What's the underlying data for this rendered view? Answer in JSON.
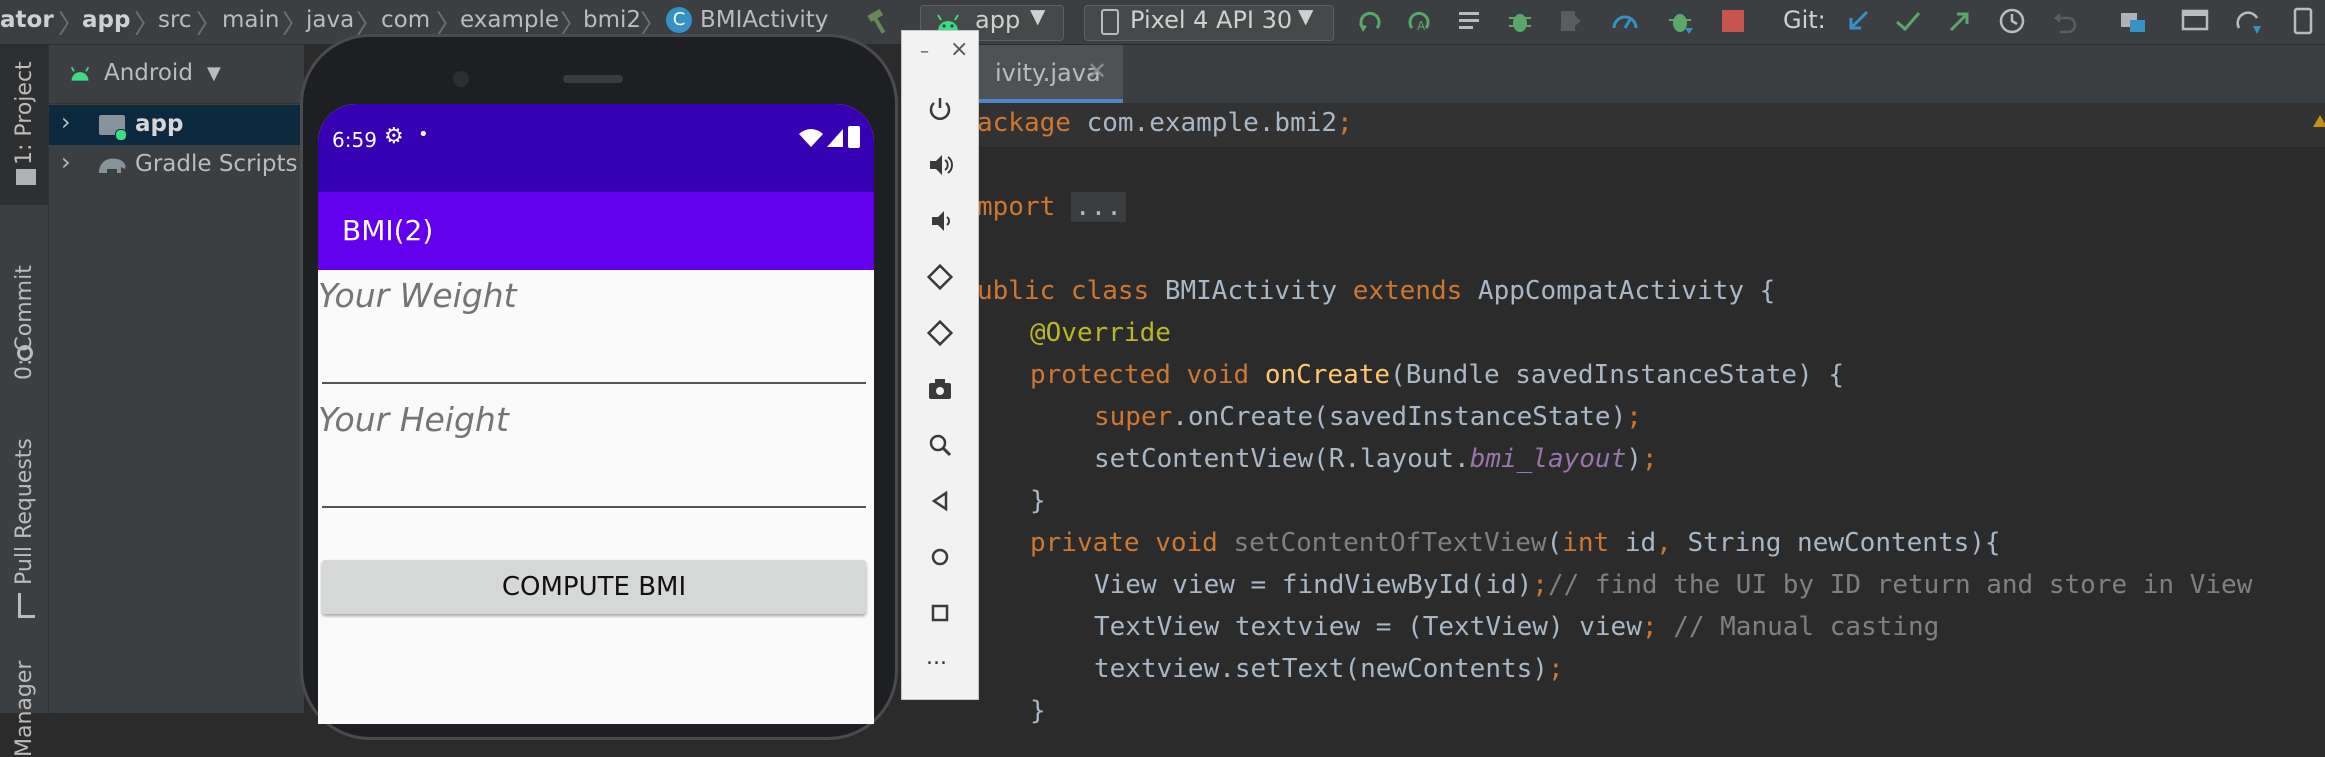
{
  "breadcrumbs": [
    "ator",
    "app",
    "src",
    "main",
    "java",
    "com",
    "example",
    "bmi2",
    "BMIActivity"
  ],
  "toolbar": {
    "run_config": "app",
    "device": "Pixel 4 API 30",
    "git_label": "Git:"
  },
  "left_strip": {
    "project_tab": "1: Project",
    "commit_tab": "0: Commit",
    "pull_requests_tab": "Pull Requests",
    "manager_tab": "Manager"
  },
  "project_panel": {
    "view_selector": "Android",
    "tree": [
      {
        "label": "app",
        "bold": true
      },
      {
        "label": "Gradle Scripts",
        "bold": false
      }
    ]
  },
  "editor_tab": {
    "label": "ivity.java"
  },
  "phone": {
    "status_time": "6:59",
    "app_title": "BMI(2)",
    "weight_hint": "Your Weight",
    "height_hint": "Your Height",
    "compute_button": "COMPUTE BMI"
  },
  "emulator": {
    "minimize": "–",
    "close": "×",
    "more": "..."
  },
  "code_lines": {
    "l1a": "ackage ",
    "l1b": "com.example.bmi2",
    "l1c": ";",
    "l2a": "mport ",
    "l2b": "...",
    "l3a": "ublic class ",
    "l3b": "BMIActivity ",
    "l3c": "extends ",
    "l3d": "AppCompatActivity {",
    "l4": "@Override",
    "l5a": "protected void ",
    "l5b": "onCreate",
    "l5c": "(Bundle savedInstanceState) {",
    "l6a": "super",
    "l6b": ".onCreate(savedInstanceState)",
    "l6c": ";",
    "l7a": "setContentView(R.layout.",
    "l7b": "bmi_layout",
    "l7c": ")",
    "l7d": ";",
    "l8": "}",
    "l9a": "private void ",
    "l9b": "setContentOfTextView",
    "l9c": "(",
    "l9d": "int ",
    "l9e": "id",
    "l9f": ", ",
    "l9g": "String newContents){",
    "l10a": "View view = findViewById(id)",
    "l10b": ";",
    "l10c": "// find the UI by ID return and store in View",
    "l11a": "TextView textview = (TextView) view",
    "l11b": "; ",
    "l11c": "// Manual casting",
    "l12a": "textview.setText(newContents)",
    "l12b": ";",
    "l13": "}"
  },
  "colors": {
    "status_bar": "#3700b3",
    "app_bar": "#6200ee",
    "keyword": "#cc7832",
    "annotation": "#bbb529",
    "method": "#ffc66d",
    "comment": "#808080"
  }
}
